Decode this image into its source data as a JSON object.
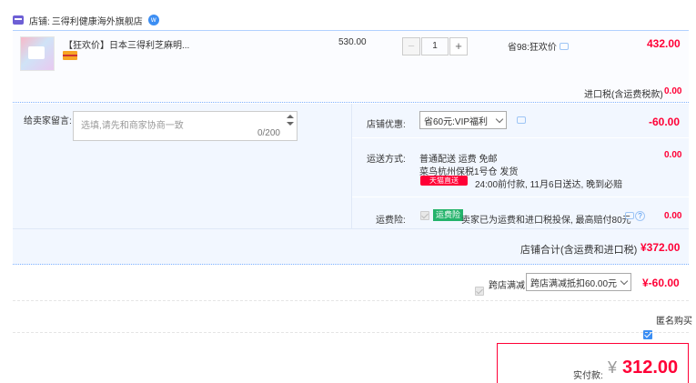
{
  "shop": {
    "label": "店铺:",
    "name": "三得利健康海外旗舰店"
  },
  "item": {
    "title": "【狂欢价】日本三得利芝麻明...",
    "unit_price": "530.00",
    "quantity": "1",
    "discount": "省98:狂欢价",
    "subtotal": "432.00",
    "import_tax_label": "进口税(含运费税款)",
    "import_tax_value": "0.00"
  },
  "message": {
    "label": "给卖家留言:",
    "placeholder": "选填,请先和商家协商一致",
    "counter": "0/200"
  },
  "shop_coupon": {
    "label": "店铺优惠:",
    "selected": "省60元:VIP福利",
    "value": "-60.00"
  },
  "shipping": {
    "label": "运送方式:",
    "method": "普通配送 运费 免邮",
    "warehouse": "菜鸟杭州保税1号仓  发货",
    "badge": "天猫直送",
    "delivery_note": "24:00前付款, 11月6日送达, 晚到必赔",
    "value": "0.00"
  },
  "insurance": {
    "label": "运费险:",
    "badge": "运费险",
    "text": "卖家已为运费和进口税投保, 最高赔付80元",
    "value": "0.00"
  },
  "shop_total": {
    "label": "店铺合计(含运费和进口税)",
    "value": "¥372.00"
  },
  "cross_store": {
    "label": "跨店满减",
    "selected": "跨店满减抵扣60.00元",
    "value": "¥-60.00"
  },
  "anonymous": {
    "label": "匿名购买"
  },
  "payment": {
    "label": "实付款:",
    "currency": "¥",
    "amount": "312.00"
  },
  "colors": {
    "accent_red": "#ff0036",
    "accent_blue": "#3c8ef3",
    "panel_blue": "#f2f7ff"
  }
}
